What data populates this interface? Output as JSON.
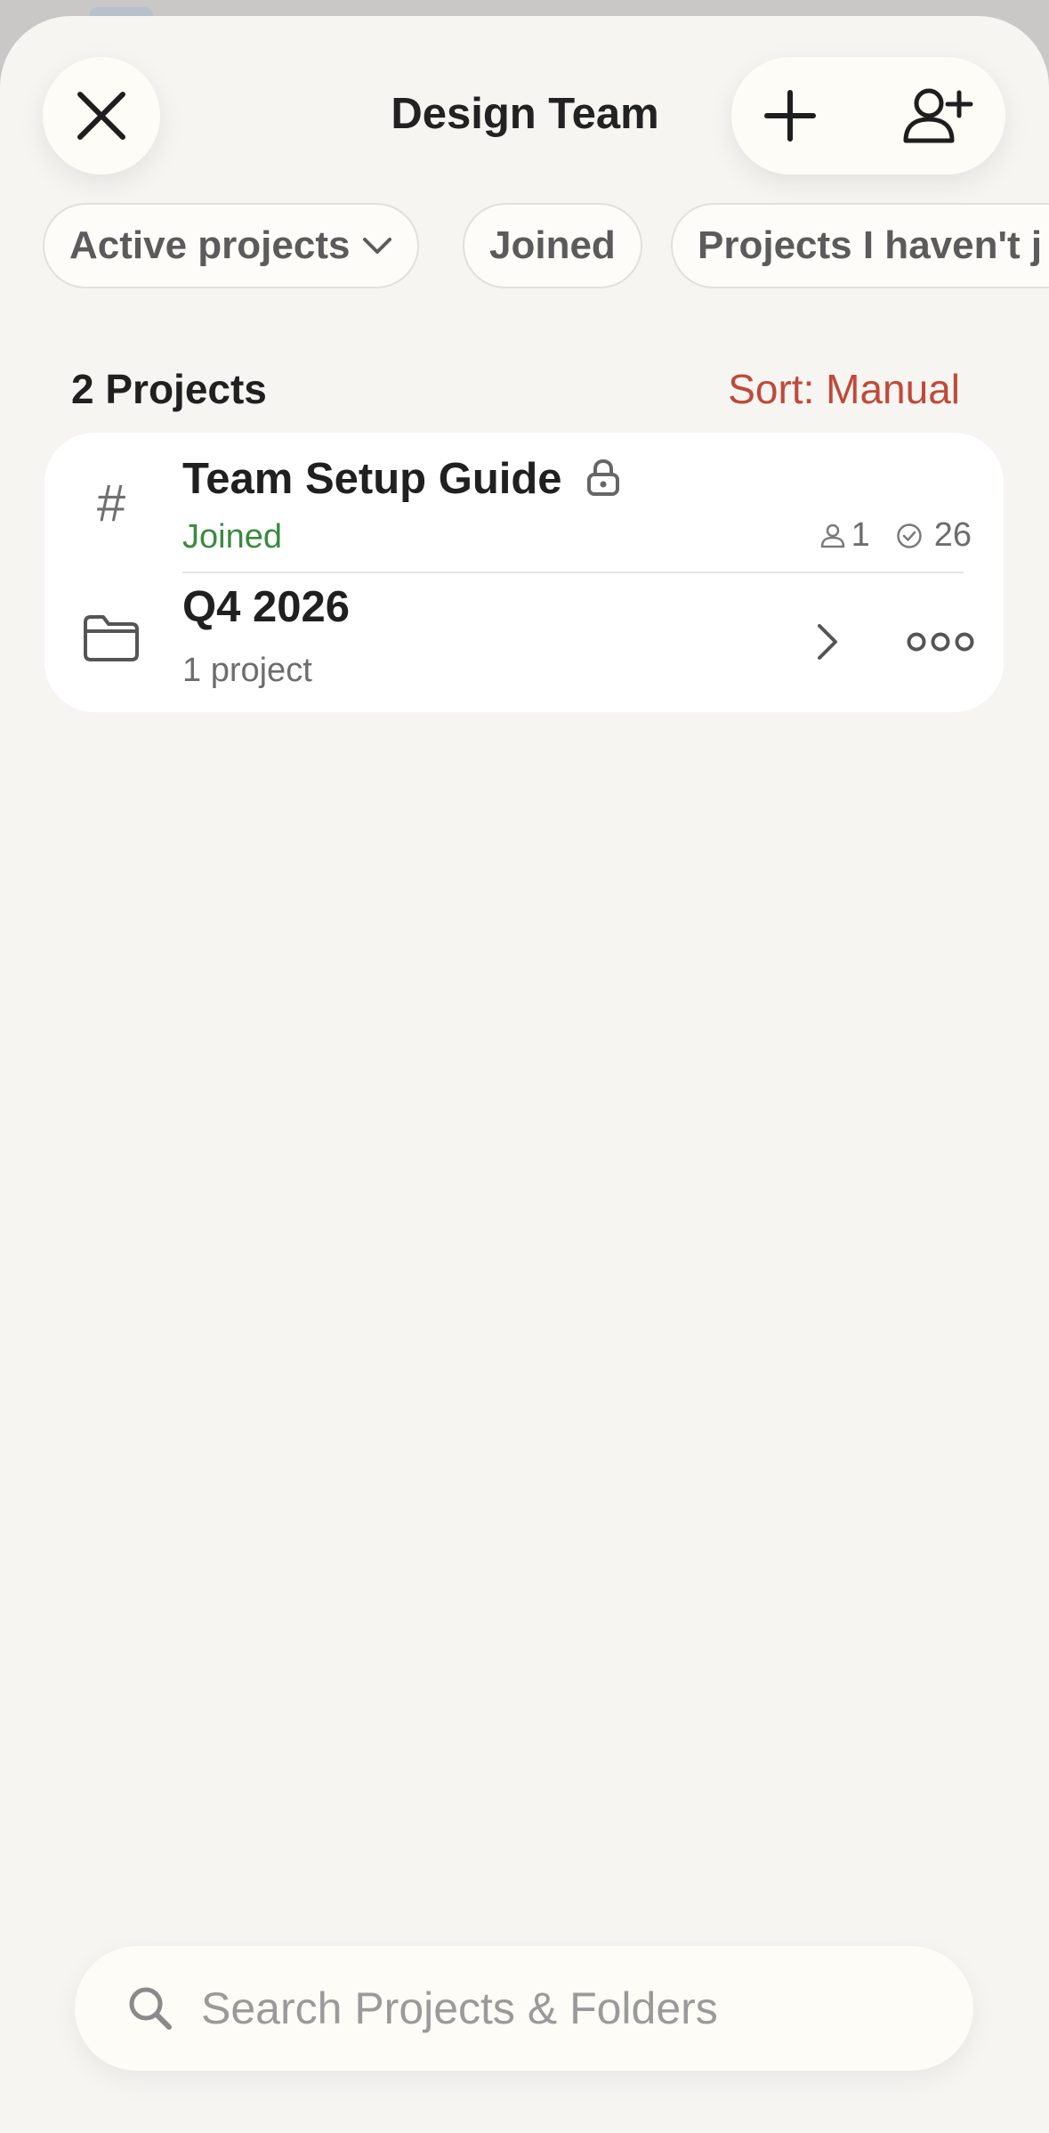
{
  "header": {
    "title": "Design Team",
    "close_icon": "close-icon",
    "add_icon": "plus-icon",
    "add_member_icon": "add-person-icon"
  },
  "filters": [
    {
      "label": "Active projects",
      "has_dropdown": true
    },
    {
      "label": "Joined"
    },
    {
      "label": "Projects I haven't j"
    }
  ],
  "list_header": {
    "count_label": "2 Projects",
    "sort_label": "Sort: Manual"
  },
  "items": [
    {
      "type": "project",
      "icon": "hash-icon",
      "icon_glyph": "#",
      "name": "Team Setup Guide",
      "locked": true,
      "status": "Joined",
      "members": "1",
      "tasks": "26"
    },
    {
      "type": "folder",
      "icon": "folder-icon",
      "name": "Q4 2026",
      "subtitle": "1 project"
    }
  ],
  "search": {
    "placeholder": "Search Projects & Folders",
    "value": ""
  },
  "colors": {
    "accent": "#c0493a",
    "joined": "#3a8a3f",
    "background": "#f6f5f2"
  }
}
